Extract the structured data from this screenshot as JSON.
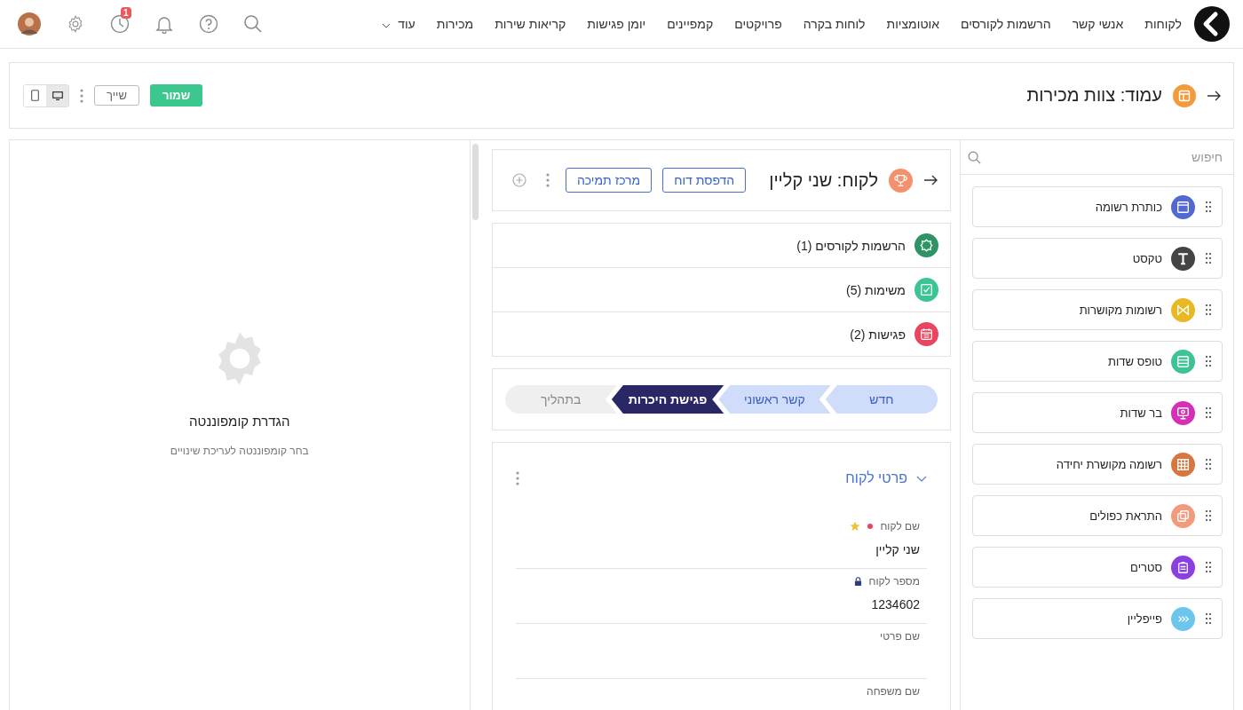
{
  "nav": {
    "items": [
      {
        "label": "לקוחות"
      },
      {
        "label": "אנשי קשר"
      },
      {
        "label": "הרשמות לקורסים"
      },
      {
        "label": "אוטומציות"
      },
      {
        "label": "לוחות בקרה"
      },
      {
        "label": "פרויקטים"
      },
      {
        "label": "קמפיינים"
      },
      {
        "label": "יומן פגישות"
      },
      {
        "label": "קריאות שירות"
      },
      {
        "label": "מכירות"
      }
    ],
    "more": "עוד",
    "notification_count": "1"
  },
  "page_bar": {
    "title": "עמוד: צוות מכירות",
    "view_modes": [
      {
        "kind": "desktop",
        "selected": true
      },
      {
        "kind": "tablet",
        "selected": false
      }
    ],
    "assign_button": "שייך",
    "save_button": "שמור"
  },
  "components_panel": {
    "search_placeholder": "חיפוש",
    "items": [
      {
        "name": "כותרת רשומה",
        "kind": "header",
        "color": "#5468d4"
      },
      {
        "name": "טקסט",
        "kind": "text",
        "color": "#444444"
      },
      {
        "name": "רשומות מקושרות",
        "kind": "related",
        "color": "#e9b825"
      },
      {
        "name": "טופס שדות",
        "kind": "form",
        "color": "#3cc495"
      },
      {
        "name": "בר שדות",
        "kind": "bar",
        "color": "#d62fb5"
      },
      {
        "name": "רשומה מקושרת יחידה",
        "kind": "grid",
        "color": "#d8763e"
      },
      {
        "name": "התראת כפולים",
        "kind": "duplicate",
        "color": "#f49a7c"
      },
      {
        "name": "סטרים",
        "kind": "stream",
        "color": "#8a3fe0"
      },
      {
        "name": "פייפליין",
        "kind": "pipeline",
        "color": "#6cc6ec"
      }
    ]
  },
  "record_header": {
    "title": "לקוח: שני קליין",
    "buttons": [
      "הדפסת דוח",
      "מרכז תמיכה"
    ]
  },
  "related_lists": [
    {
      "label": "הרשמות לקורסים (1)",
      "kind": "badge",
      "color": "#2e9466"
    },
    {
      "label": "משימות (5)",
      "kind": "check",
      "color": "#3cc495"
    },
    {
      "label": "פגישות (2)",
      "kind": "calendar",
      "color": "#e9455e"
    }
  ],
  "pipeline": {
    "stages": [
      {
        "label": "חדש",
        "completed": true,
        "selected": false
      },
      {
        "label": "קשר ראשוני",
        "completed": true,
        "selected": false
      },
      {
        "label": "פגישת היכרות",
        "completed": false,
        "selected": true
      },
      {
        "label": "בתהליך",
        "completed": false,
        "selected": false
      }
    ]
  },
  "field_group": {
    "title": "פרטי לקוח",
    "expanded": true,
    "fields": [
      {
        "label": "שם לקוח",
        "value": "שני קליין",
        "required": true,
        "primary": true,
        "locked": false
      },
      {
        "label": "מספר לקוח",
        "value": "1234602",
        "required": false,
        "primary": false,
        "locked": true
      },
      {
        "label": "שם פרטי",
        "required": false,
        "primary": false,
        "locked": false
      },
      {
        "label": "שם משפחה",
        "required": false,
        "primary": false,
        "locked": false
      }
    ]
  },
  "settings_panel": {
    "title": "הגדרת קומפוננטה",
    "hint": "בחר קומפוננטה לעריכת שינויים"
  }
}
